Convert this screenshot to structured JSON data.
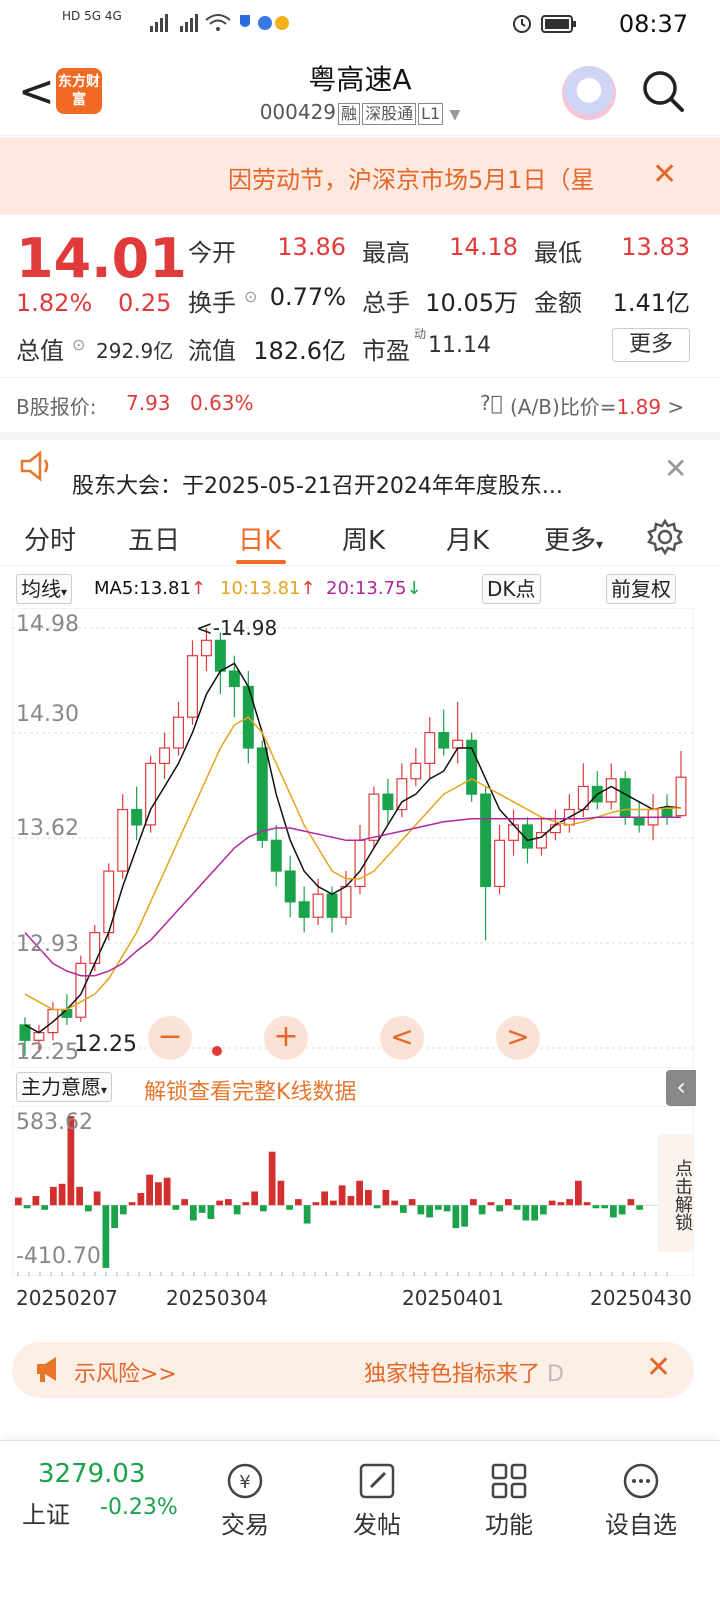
{
  "status": {
    "time": "08:37",
    "left": "HD 5G 4G"
  },
  "header": {
    "back": "<",
    "logo": "东方财富",
    "title": "粤高速A",
    "code": "000429",
    "tags": [
      "融",
      "深股通",
      "L1"
    ]
  },
  "notice": {
    "text": "因劳动节，沪深京市场5月1日（星",
    "close": "✕"
  },
  "quote": {
    "price": "14.01",
    "change_pct": "1.82%",
    "change": "0.25",
    "open_label": "今开",
    "open": "13.86",
    "high_label": "最高",
    "high": "14.18",
    "low_label": "最低",
    "low": "13.83",
    "turnover_label": "换手",
    "turnover": "0.77%",
    "volume_label": "总手",
    "volume": "10.05万",
    "amount_label": "金额",
    "amount": "1.41亿",
    "mcap_label": "总值",
    "mcap": "292.9亿",
    "float_label": "流值",
    "float": "182.6亿",
    "pe_label": "市盈",
    "pe_sup": "动",
    "pe": "11.14",
    "more": "更多",
    "b_label": "B股报价:",
    "b_price": "7.93",
    "b_pct": "0.63%",
    "ab_label": "(A/B)比价=",
    "ab_val": "1.89",
    "ab_arrow": ">"
  },
  "announce": {
    "text": "股东大会：于2025-05-21召开2024年年度股东...",
    "close": "✕"
  },
  "tabs": [
    "分时",
    "五日",
    "日K",
    "周K",
    "月K",
    "更多"
  ],
  "ma": {
    "selector": "均线",
    "ma5": "MA5:13.81",
    "ma10": "10:13.81",
    "ma20": "20:13.75",
    "dk": "DK点",
    "fq": "前复权",
    "colors": {
      "ma5": "#111111",
      "ma10": "#e9a21b",
      "ma20": "#b0279b"
    }
  },
  "chart_data": [
    {
      "type": "candlestick",
      "y_ticks": [
        "14.98",
        "14.30",
        "13.62",
        "12.93",
        "12.25"
      ],
      "ylim": [
        12.25,
        14.98
      ],
      "high_marker": "<-14.98",
      "low_marker": "12.25",
      "series": [
        {
          "name": "MA5",
          "values": [
            12.4,
            12.35,
            12.42,
            12.5,
            12.6,
            12.8,
            13.0,
            13.3,
            13.55,
            13.8,
            13.95,
            14.1,
            14.3,
            14.55,
            14.7,
            14.75,
            14.6,
            14.3,
            13.9,
            13.6,
            13.4,
            13.3,
            13.25,
            13.3,
            13.4,
            13.55,
            13.7,
            13.85,
            13.9,
            14.0,
            14.05,
            14.2,
            14.2,
            14.0,
            13.8,
            13.7,
            13.6,
            13.62,
            13.7,
            13.75,
            13.8,
            13.9,
            13.95,
            13.9,
            13.85,
            13.8,
            13.82,
            13.81
          ]
        },
        {
          "name": "MA10",
          "values": [
            12.6,
            12.55,
            12.5,
            12.5,
            12.55,
            12.6,
            12.7,
            12.85,
            13.0,
            13.2,
            13.4,
            13.6,
            13.8,
            14.0,
            14.2,
            14.35,
            14.4,
            14.3,
            14.1,
            13.9,
            13.7,
            13.55,
            13.4,
            13.35,
            13.35,
            13.4,
            13.5,
            13.6,
            13.7,
            13.8,
            13.9,
            13.95,
            14.0,
            13.95,
            13.9,
            13.85,
            13.8,
            13.75,
            13.72,
            13.7,
            13.72,
            13.75,
            13.78,
            13.8,
            13.8,
            13.8,
            13.81,
            13.81
          ]
        },
        {
          "name": "MA20",
          "values": [
            13.0,
            12.9,
            12.8,
            12.75,
            12.72,
            12.72,
            12.75,
            12.8,
            12.88,
            12.95,
            13.05,
            13.15,
            13.25,
            13.35,
            13.45,
            13.55,
            13.62,
            13.66,
            13.68,
            13.68,
            13.66,
            13.64,
            13.62,
            13.6,
            13.6,
            13.62,
            13.64,
            13.66,
            13.68,
            13.7,
            13.72,
            13.73,
            13.74,
            13.74,
            13.74,
            13.74,
            13.74,
            13.74,
            13.74,
            13.74,
            13.74,
            13.75,
            13.75,
            13.75,
            13.75,
            13.75,
            13.75,
            13.75
          ]
        }
      ],
      "candles": [
        [
          12.4,
          12.3,
          12.45,
          12.2
        ],
        [
          12.3,
          12.35,
          12.4,
          12.22
        ],
        [
          12.35,
          12.5,
          12.55,
          12.3
        ],
        [
          12.5,
          12.45,
          12.6,
          12.4
        ],
        [
          12.45,
          12.8,
          12.85,
          12.42
        ],
        [
          12.8,
          13.0,
          13.05,
          12.75
        ],
        [
          13.0,
          13.4,
          13.45,
          12.95
        ],
        [
          13.4,
          13.8,
          13.9,
          13.35
        ],
        [
          13.8,
          13.7,
          13.95,
          13.6
        ],
        [
          13.7,
          14.1,
          14.15,
          13.65
        ],
        [
          14.1,
          14.2,
          14.3,
          14.0
        ],
        [
          14.2,
          14.4,
          14.5,
          14.15
        ],
        [
          14.4,
          14.8,
          14.9,
          14.35
        ],
        [
          14.8,
          14.9,
          14.98,
          14.7
        ],
        [
          14.9,
          14.7,
          14.95,
          14.55
        ],
        [
          14.7,
          14.6,
          14.8,
          14.4
        ],
        [
          14.6,
          14.2,
          14.7,
          14.1
        ],
        [
          14.2,
          13.6,
          14.25,
          13.55
        ],
        [
          13.6,
          13.4,
          13.7,
          13.3
        ],
        [
          13.4,
          13.2,
          13.5,
          13.1
        ],
        [
          13.2,
          13.1,
          13.3,
          13.0
        ],
        [
          13.1,
          13.25,
          13.35,
          13.05
        ],
        [
          13.25,
          13.1,
          13.3,
          13.0
        ],
        [
          13.1,
          13.3,
          13.4,
          13.05
        ],
        [
          13.3,
          13.6,
          13.7,
          13.25
        ],
        [
          13.6,
          13.9,
          13.95,
          13.55
        ],
        [
          13.9,
          13.8,
          14.0,
          13.7
        ],
        [
          13.8,
          14.0,
          14.1,
          13.75
        ],
        [
          14.0,
          14.1,
          14.2,
          13.95
        ],
        [
          14.1,
          14.3,
          14.4,
          14.0
        ],
        [
          14.3,
          14.2,
          14.45,
          14.15
        ],
        [
          14.2,
          14.25,
          14.5,
          14.1
        ],
        [
          14.25,
          13.9,
          14.3,
          13.85
        ],
        [
          13.9,
          13.3,
          13.95,
          12.95
        ],
        [
          13.3,
          13.6,
          13.7,
          13.25
        ],
        [
          13.6,
          13.7,
          13.8,
          13.5
        ],
        [
          13.7,
          13.55,
          13.75,
          13.45
        ],
        [
          13.55,
          13.65,
          13.75,
          13.5
        ],
        [
          13.65,
          13.7,
          13.8,
          13.6
        ],
        [
          13.7,
          13.8,
          13.9,
          13.65
        ],
        [
          13.8,
          13.95,
          14.1,
          13.75
        ],
        [
          13.95,
          13.85,
          14.05,
          13.8
        ],
        [
          13.85,
          14.0,
          14.1,
          13.8
        ],
        [
          14.0,
          13.75,
          14.05,
          13.7
        ],
        [
          13.75,
          13.7,
          13.85,
          13.65
        ],
        [
          13.7,
          13.8,
          13.9,
          13.6
        ],
        [
          13.8,
          13.75,
          13.9,
          13.7
        ],
        [
          13.76,
          14.01,
          14.18,
          13.83
        ]
      ]
    },
    {
      "type": "bar",
      "title": "主力意愿",
      "y_ticks": [
        "583.62",
        "-410.70"
      ],
      "ylim": [
        -410.7,
        583.62
      ],
      "values": [
        50,
        -20,
        60,
        -30,
        120,
        140,
        583,
        120,
        -40,
        90,
        -410,
        -150,
        -60,
        20,
        80,
        200,
        150,
        180,
        -30,
        40,
        -100,
        -50,
        -90,
        30,
        40,
        -60,
        20,
        90,
        -40,
        350,
        160,
        -30,
        40,
        -120,
        20,
        90,
        30,
        130,
        60,
        160,
        100,
        -20,
        100,
        30,
        -50,
        40,
        -60,
        -80,
        -30,
        -40,
        -150,
        -140,
        40,
        -60,
        20,
        -40,
        40,
        -30,
        -100,
        -100,
        -60,
        30,
        20,
        40,
        160,
        20,
        -20,
        -20,
        -80,
        -60,
        40,
        -30
      ]
    }
  ],
  "chart_controls": {
    "zoom_out": "−",
    "zoom_in": "+",
    "prev": "<",
    "next": ">"
  },
  "indicator": {
    "selector": "主力意愿",
    "unlock": "解锁查看完整K线数据",
    "side_unlock": "点击解锁"
  },
  "dates": [
    "20250207",
    "20250304",
    "20250401",
    "20250430"
  ],
  "risk": {
    "left": "示风险>>",
    "right": "独家特色指标来了",
    "right_suffix": "D",
    "close": "✕"
  },
  "bottom": {
    "index_value": "3279.03",
    "index_name": "上证",
    "index_change": "-0.23%",
    "items": [
      "交易",
      "发帖",
      "功能",
      "设自选"
    ]
  }
}
